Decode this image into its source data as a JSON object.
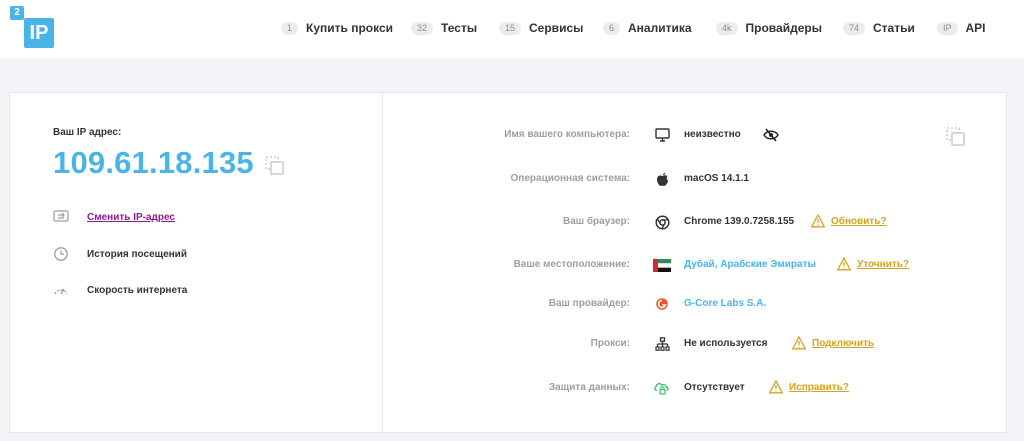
{
  "logo": {
    "small": "2",
    "main": "IP"
  },
  "nav": [
    {
      "badge": "1",
      "label": "Купить прокси"
    },
    {
      "badge": "32",
      "label": "Тесты"
    },
    {
      "badge": "15",
      "label": "Сервисы"
    },
    {
      "badge": "6",
      "label": "Аналитика"
    },
    {
      "badge": "4k",
      "label": "Провайдеры"
    },
    {
      "badge": "74",
      "label": "Статьи"
    },
    {
      "badge": "IP",
      "label": "API"
    }
  ],
  "left": {
    "ip_label": "Ваш IP адрес:",
    "ip_value": "109.61.18.135",
    "actions": [
      {
        "label": "Сменить IP-адрес",
        "icon": "swap-icon"
      },
      {
        "label": "История посещений",
        "icon": "history-icon"
      },
      {
        "label": "Скорость интернета",
        "icon": "speedometer-icon"
      }
    ]
  },
  "rows": [
    {
      "label": "Имя вашего компьютера:",
      "value": "неизвестно",
      "icon": "monitor-icon",
      "action": ""
    },
    {
      "label": "Операционная система:",
      "value": "macOS 14.1.1",
      "icon": "apple-icon",
      "action": ""
    },
    {
      "label": "Ваш браузер:",
      "value": "Chrome 139.0.7258.155",
      "icon": "chrome-icon",
      "action": "Обновить?"
    },
    {
      "label": "Ваше местоположение:",
      "value": "Дубай, Арабские Эмираты",
      "icon": "uae-flag-icon",
      "action": "Уточнить?"
    },
    {
      "label": "Ваш провайдер:",
      "value": "G-Core Labs S.A.",
      "icon": "provider-icon",
      "action": ""
    },
    {
      "label": "Прокси:",
      "value": "Не используется",
      "icon": "network-icon",
      "action": "Подключить"
    },
    {
      "label": "Защита данных:",
      "value": "Отсутствует",
      "icon": "cloud-lock-icon",
      "action": "Исправить?"
    }
  ],
  "colors": {
    "accent": "#4ab4e6",
    "warning": "#d4a41b",
    "link": "#8b1e93"
  }
}
